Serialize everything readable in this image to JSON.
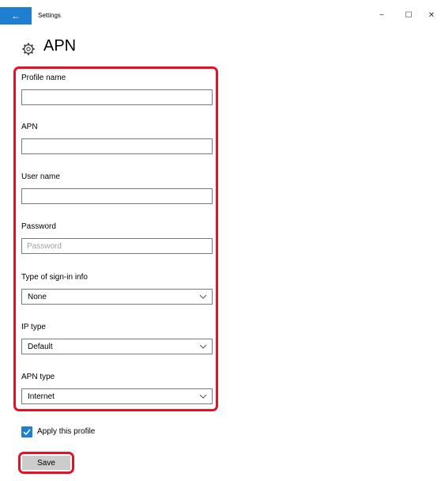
{
  "window": {
    "title": "Settings",
    "back_glyph": "←",
    "minimize_glyph": "−",
    "maximize_glyph": "☐",
    "close_glyph": "✕"
  },
  "page": {
    "title": "APN",
    "icon": "gear-icon"
  },
  "form": {
    "profile_name": {
      "label": "Profile name",
      "value": "",
      "placeholder": ""
    },
    "apn": {
      "label": "APN",
      "value": "",
      "placeholder": ""
    },
    "user_name": {
      "label": "User name",
      "value": "",
      "placeholder": ""
    },
    "password": {
      "label": "Password",
      "value": "",
      "placeholder": "Password"
    },
    "sign_in_type": {
      "label": "Type of sign-in info",
      "selected": "None"
    },
    "ip_type": {
      "label": "IP type",
      "selected": "Default"
    },
    "apn_type": {
      "label": "APN type",
      "selected": "Internet"
    }
  },
  "apply_profile": {
    "label": "Apply this profile",
    "checked": true
  },
  "save_button": {
    "label": "Save"
  },
  "colors": {
    "accent": "#1e7fd1",
    "highlight": "#e81123",
    "button_bg": "#cccccc"
  }
}
